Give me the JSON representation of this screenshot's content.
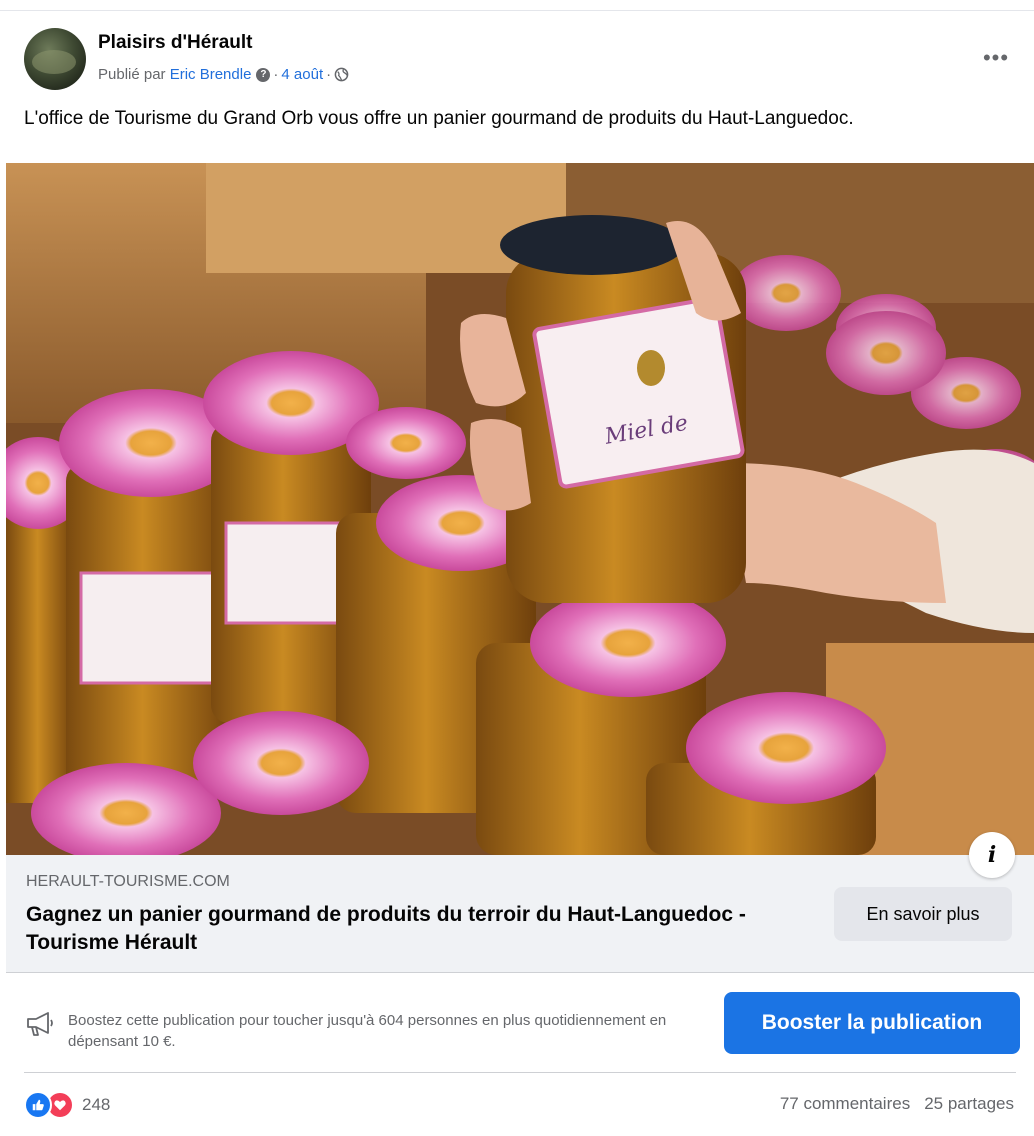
{
  "post": {
    "page_name": "Plaisirs d'Hérault",
    "published_by_prefix": "Publié par",
    "author": "Eric Brendle",
    "separator": "·",
    "date": "4 août",
    "text": "L'office de Tourisme du Grand Orb vous offre un panier gourmand de produits du Haut-Languedoc.",
    "icons": {
      "more": "more-options-icon",
      "info": "info-icon",
      "privacy": "globe-icon",
      "verified_help": "question-icon"
    }
  },
  "link_preview": {
    "domain": "HERAULT-TOURISME.COM",
    "title": "Gagnez un panier gourmand de produits du terroir du Haut-Languedoc - Tourisme Hérault",
    "cta_label": "En savoir plus"
  },
  "boost": {
    "text": "Boostez cette publication pour toucher jusqu'à 604 personnes en plus quotidiennement en dépensant 10 €.",
    "button_label": "Booster la publication",
    "accent_color": "#1b74e4"
  },
  "engagement": {
    "reaction_count": "248",
    "comments": "77 commentaires",
    "shares": "25 partages",
    "like_color": "#1877f2",
    "love_color": "#f33e58"
  }
}
